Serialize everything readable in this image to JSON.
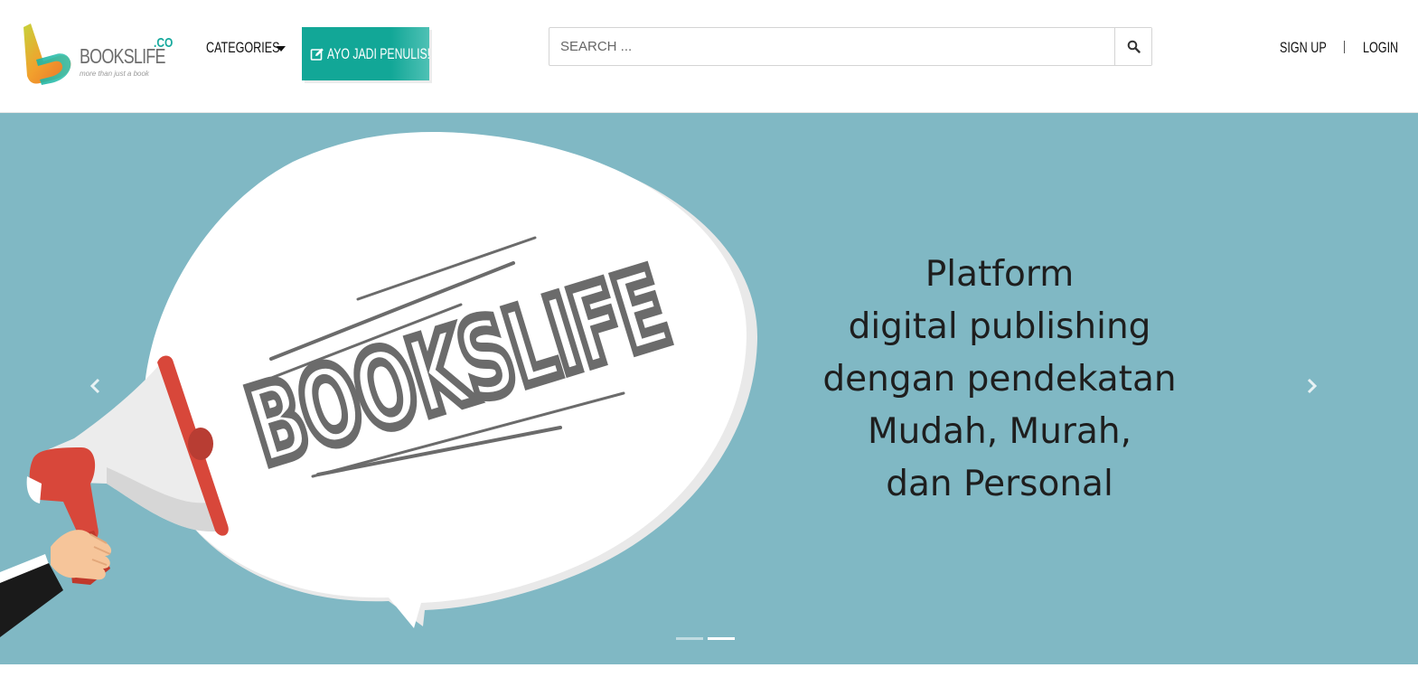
{
  "header": {
    "logo": {
      "wordmark": "BOOKSLIFE",
      "suffix": ".CO",
      "tagline": "more than just a book"
    },
    "nav": {
      "categories_label": "CATEGORIES",
      "write_button_label": "AYO JADI PENULIS!"
    },
    "search": {
      "placeholder": "SEARCH ..."
    },
    "auth": {
      "signup_label": "SIGN UP",
      "login_label": "LOGIN"
    }
  },
  "hero": {
    "art_text": "BOOKSLIFE",
    "tagline_lines": [
      "Platform",
      "digital publishing",
      "dengan pendekatan",
      "Mudah, Murah,",
      "dan Personal"
    ],
    "slides_total": 2,
    "active_slide": 2
  },
  "colors": {
    "accent": "#12a797",
    "hero_background": "#80b8c4",
    "megaphone_red": "#d8473a"
  },
  "icons": {
    "logo": "bookslife-logo",
    "categories_caret": "caret-down-icon",
    "write": "edit-icon",
    "search": "search-icon",
    "prev": "chevron-left-icon",
    "next": "chevron-right-icon"
  }
}
